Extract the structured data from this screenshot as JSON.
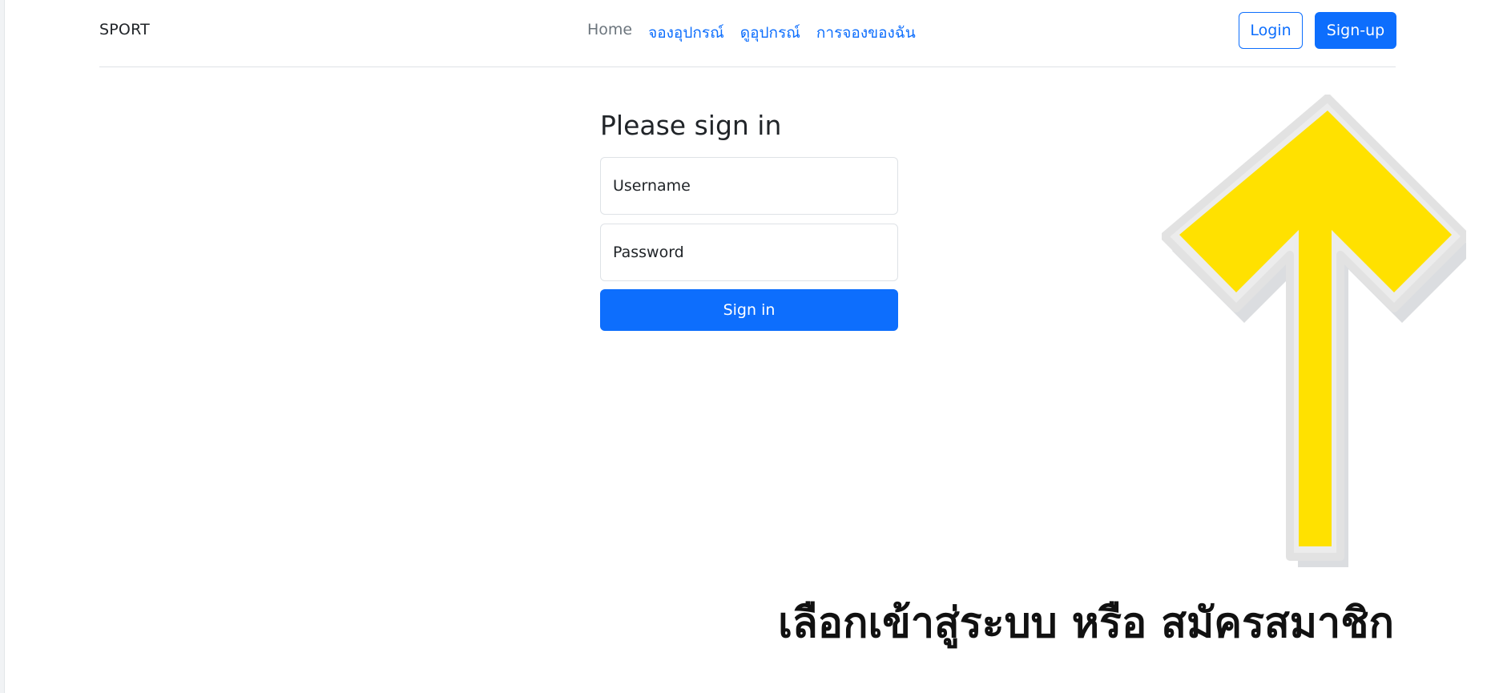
{
  "header": {
    "brand": "SPORT",
    "nav": [
      {
        "label": "Home"
      },
      {
        "label": "จองอุปกรณ์"
      },
      {
        "label": "ดูอุปกรณ์"
      },
      {
        "label": "การจองของฉัน"
      }
    ],
    "login_label": "Login",
    "signup_label": "Sign-up"
  },
  "signin": {
    "title": "Please sign in",
    "username_placeholder": "Username",
    "password_placeholder": "Password",
    "submit_label": "Sign in"
  },
  "annotation": {
    "caption": "เลือกเข้าสู่ระบบ หรือ สมัครสมาชิก",
    "arrow_icon": "up-arrow-icon",
    "arrow_color": "#FFE100"
  },
  "colors": {
    "primary": "#0d6efd",
    "muted": "#6c757d"
  }
}
